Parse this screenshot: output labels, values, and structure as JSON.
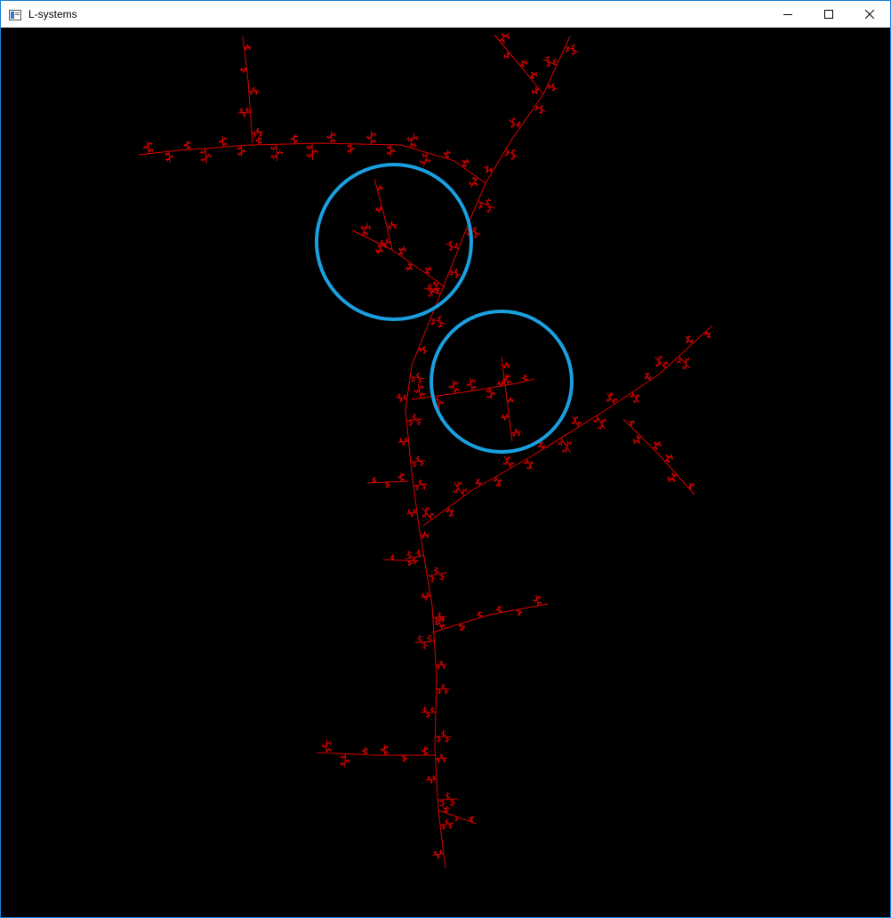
{
  "window": {
    "title": "L-systems",
    "icon": "window-app-icon",
    "controls": [
      "minimize-icon",
      "maximize-icon",
      "close-icon"
    ]
  },
  "canvas": {
    "background": "#000000",
    "fractal_color": "#e00000",
    "highlight_color": "#1a9fe0"
  }
}
